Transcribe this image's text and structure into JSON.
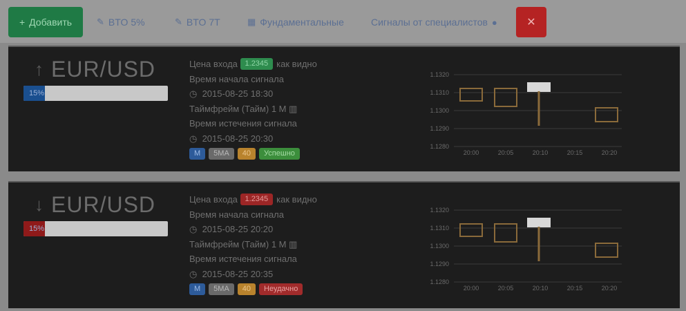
{
  "toolbar": {
    "primary_label": "Добавить",
    "links": [
      {
        "icon": "pencil-icon",
        "label": "BTO 5%"
      },
      {
        "icon": "pencil-icon",
        "label": "BTO 7T"
      },
      {
        "icon": "calendar-icon",
        "label": "Фундаментальные"
      },
      {
        "icon": "info-icon",
        "label": "Сигналы от специалистов"
      }
    ],
    "close_glyph": "✕",
    "accent": "#1f7a45",
    "danger": "#b52323"
  },
  "signals": [
    {
      "pair": "EUR/USD",
      "direction": "up",
      "direction_glyph": "↑",
      "progress_label": "15%",
      "progress": 0.15,
      "progress_color": "#1a4f8f",
      "price_label": "Цена входа",
      "price_value": "1.2345",
      "price_note": "как видно",
      "open_label": "Время начала сигнала",
      "open_time": "2015-08-25 18:30",
      "timeframe_label": "Таймфрейм (Тайм)",
      "timeframe_value": "1 М",
      "close_label": "Время истечения сигнала",
      "close_time": "2015-08-25 20:30",
      "tags": [
        "M",
        "5MA",
        "40",
        "Успешно"
      ],
      "tag_classes": [
        "b-blue",
        "b-gray",
        "b-orange",
        "b-stgreen"
      ],
      "price_badge": "b-green",
      "chart_data": {
        "type": "candlestick",
        "y_ticks": [
          "1.1320",
          "1.1310",
          "1.1300",
          "1.1290",
          "1.1280"
        ],
        "x_ticks": [
          "20:00",
          "20:05",
          "20:10",
          "20:15",
          "20:20"
        ]
      }
    },
    {
      "pair": "EUR/USD",
      "direction": "down",
      "direction_glyph": "↓",
      "progress_label": "15%",
      "progress": 0.15,
      "progress_color": "#8f1a1a",
      "price_label": "Цена входа",
      "price_value": "1.2345",
      "price_note": "как видно",
      "open_label": "Время начала сигнала",
      "open_time": "2015-08-25 20:20",
      "timeframe_label": "Таймфрейм (Тайм)",
      "timeframe_value": "1 М",
      "close_label": "Время истечения сигнала",
      "close_time": "2015-08-25 20:35",
      "tags": [
        "M",
        "5MA",
        "40",
        "Неудачно"
      ],
      "tag_classes": [
        "b-blue",
        "b-gray",
        "b-orange",
        "b-stred"
      ],
      "price_badge": "b-red",
      "chart_data": {
        "type": "candlestick",
        "y_ticks": [
          "1.1320",
          "1.1310",
          "1.1300",
          "1.1290",
          "1.1280"
        ],
        "x_ticks": [
          "20:00",
          "20:05",
          "20:10",
          "20:15",
          "20:20"
        ]
      }
    }
  ]
}
